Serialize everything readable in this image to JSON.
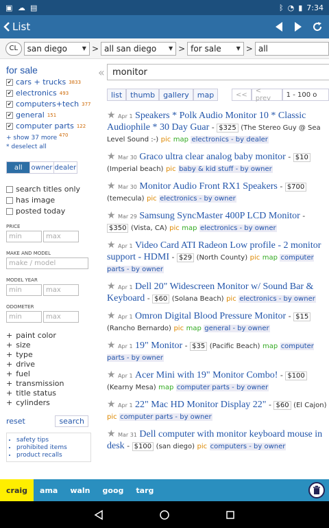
{
  "statusbar": {
    "time": "7:34"
  },
  "appbar": {
    "title": "List"
  },
  "filters": {
    "badge": "CL",
    "city": "san diego",
    "area": "all san diego",
    "section": "for sale",
    "category": "all",
    "separator": ">"
  },
  "sidebar": {
    "heading": "for sale",
    "categories": [
      {
        "label": "cars + trucks",
        "count": "3833"
      },
      {
        "label": "electronics",
        "count": "493"
      },
      {
        "label": "computers+tech",
        "count": "377"
      },
      {
        "label": "general",
        "count": "151"
      },
      {
        "label": "computer parts",
        "count": "122"
      }
    ],
    "show_more": "+ show 37 more",
    "show_more_count": "470",
    "deselect": "* deselect all",
    "owner_tabs": [
      "all",
      "owner",
      "dealer"
    ],
    "options": [
      "search titles only",
      "has image",
      "posted today"
    ],
    "price_label": "PRICE",
    "min": "min",
    "max": "max",
    "make_label": "MAKE AND MODEL",
    "make_placeholder": "make / model",
    "year_label": "MODEL YEAR",
    "odometer_label": "ODOMETER",
    "expanders": [
      "paint color",
      "size",
      "type",
      "drive",
      "fuel",
      "transmission",
      "title status",
      "cylinders"
    ],
    "reset": "reset",
    "search": "search",
    "links": [
      "safety tips",
      "prohibited items",
      "product recalls"
    ]
  },
  "main": {
    "query": "monitor",
    "views": [
      "list",
      "thumb",
      "gallery",
      "map"
    ],
    "pager": {
      "first": "<<",
      "prev": "< prev",
      "range": "1 - 100 o"
    }
  },
  "listings": [
    {
      "date": "Apr 1",
      "title": "Speakers * Polk Audio Monitor 10 * Classic Audiophile * 30 Day Guar",
      "price": "$325",
      "loc": "(The Stereo Guy @ Sea Level Sound :-)",
      "pic": "pic",
      "map": "map",
      "cat": "electronics - by dealer"
    },
    {
      "date": "Mar 30",
      "title": "Graco ultra clear analog baby monitor",
      "price": "$10",
      "loc": "(Imperial beach)",
      "pic": "pic",
      "map": "",
      "cat": "baby & kid stuff - by owner"
    },
    {
      "date": "Mar 30",
      "title": "Monitor Audio Front RX1 Speakers",
      "price": "$700",
      "loc": "(temecula)",
      "pic": "pic",
      "map": "",
      "cat": "electronics - by owner"
    },
    {
      "date": "Mar 29",
      "title": "Samsung SyncMaster 400P LCD Monitor",
      "price": "$350",
      "loc": "(Vista, CA)",
      "pic": "pic",
      "map": "map",
      "cat": "electronics - by owner"
    },
    {
      "date": "Apr 1",
      "title": "Video Card ATI Radeon Low profile - 2 monitor support - HDMI",
      "price": "$29",
      "loc": "(North County)",
      "pic": "pic",
      "map": "map",
      "cat": "computer parts - by owner"
    },
    {
      "date": "Apr 1",
      "title": "Dell 20\" Widescreen Monitor w/ Sound Bar & Keyboard",
      "price": "$60",
      "loc": "(Solana Beach)",
      "pic": "pic",
      "map": "",
      "cat": "electronics - by owner"
    },
    {
      "date": "Apr 1",
      "title": "Omron Digital Blood Pressure Monitor",
      "price": "$15",
      "loc": "(Rancho Bernardo)",
      "pic": "pic",
      "map": "map",
      "cat": "general - by owner"
    },
    {
      "date": "Apr 1",
      "title": "19\" Monitor",
      "price": "$35",
      "loc": "(Pacific Beach)",
      "pic": "",
      "map": "map",
      "cat": "computer parts - by owner"
    },
    {
      "date": "Apr 1",
      "title": "Acer Mini with 19\" Monitor Combo!",
      "price": "$100",
      "loc": "(Kearny Mesa)",
      "pic": "map",
      "map": "",
      "cat": "computer parts - by owner"
    },
    {
      "date": "Apr 1",
      "title": "22\" Mac HD Monitor Display 22\"",
      "price": "$60",
      "loc": "(El Cajon)",
      "pic": "pic",
      "map": "",
      "cat": "computer parts - by owner"
    },
    {
      "date": "Mar 31",
      "title": "Dell computer with monitor keyboard mouse in desk",
      "price": "$100",
      "loc": "(san diego)",
      "pic": "pic",
      "map": "",
      "cat": "computers - by owner"
    }
  ],
  "bottombar": {
    "tabs": [
      "craig",
      "ama",
      "waln",
      "goog",
      "targ"
    ]
  }
}
